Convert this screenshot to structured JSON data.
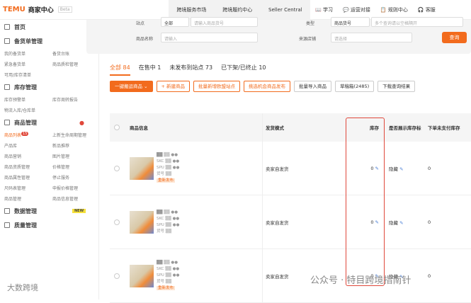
{
  "header": {
    "logo": "TEMU",
    "title": "商家中心",
    "beta": "Beta",
    "nav": [
      "跨境服务市场",
      "跨境履约中心",
      "Seller Central"
    ],
    "tools": [
      "学习",
      "运营对接",
      "规则中心",
      "客服"
    ]
  },
  "sidebar": {
    "home": "首页",
    "sections": [
      {
        "title": "备货单管理",
        "items": [
          "我的备货单",
          "备货台账",
          "紧急备货单",
          "商品质检管理",
          "可用/库存清单"
        ]
      },
      {
        "title": "库存管理",
        "items": [
          "库存预警单",
          "库存周转报告",
          "物流入库/仓库单"
        ]
      },
      {
        "title": "商品管理",
        "badge": "15",
        "items": [
          "商品列表",
          "上新生命周期管理",
          "产品库",
          "新品推荐",
          "商品营销",
          "图片管理",
          "商品资质管理",
          "价格管理",
          "商品属性管理",
          "停止服务",
          "尺码表管理",
          "申报价格管理",
          "商品管理",
          "商品信息管理"
        ]
      },
      {
        "title": "数据管理",
        "badge": "NEW"
      },
      {
        "title": "质量管理"
      }
    ]
  },
  "filter": {
    "site_label": "站点",
    "site_value": "全部",
    "site_placeholder": "请输入商品货号",
    "type_label": "类型",
    "type_value": "商品货号",
    "type_placeholder": "多个查询请以空格隔开",
    "name_label": "商品名称",
    "name_placeholder": "请输入",
    "shop_label": "来源店铺",
    "shop_placeholder": "请选择",
    "query": "查询"
  },
  "tabs": [
    "全部 84",
    "在售中 1",
    "未发布到站点 73",
    "已下架/已终止 10"
  ],
  "buttons": [
    "一键搬运商品",
    "+ 新建商品",
    "批量新增欧盟站点",
    "挑选机会商品发布",
    "批量导入商品",
    "草稿箱(2485)",
    "下载查询结果"
  ],
  "table": {
    "headers": [
      "商品信息",
      "发货模式",
      "",
      "库存",
      "是否展示库存标",
      "下单未支付库存"
    ],
    "rows": [
      {
        "tag": "重新发布",
        "mode": "卖家自发货",
        "stock": "0",
        "show": "隐藏",
        "unpaid": "0"
      },
      {
        "tag": "",
        "mode": "卖家自发货",
        "stock": "0",
        "show": "隐藏",
        "unpaid": "0"
      },
      {
        "tag": "重新发布",
        "mode": "卖家自发货",
        "stock": "0",
        "show": "隐藏",
        "unpaid": "0"
      }
    ]
  },
  "watermark": "公众号 · 特目跨境指南针",
  "watermark2": "大数跨境"
}
